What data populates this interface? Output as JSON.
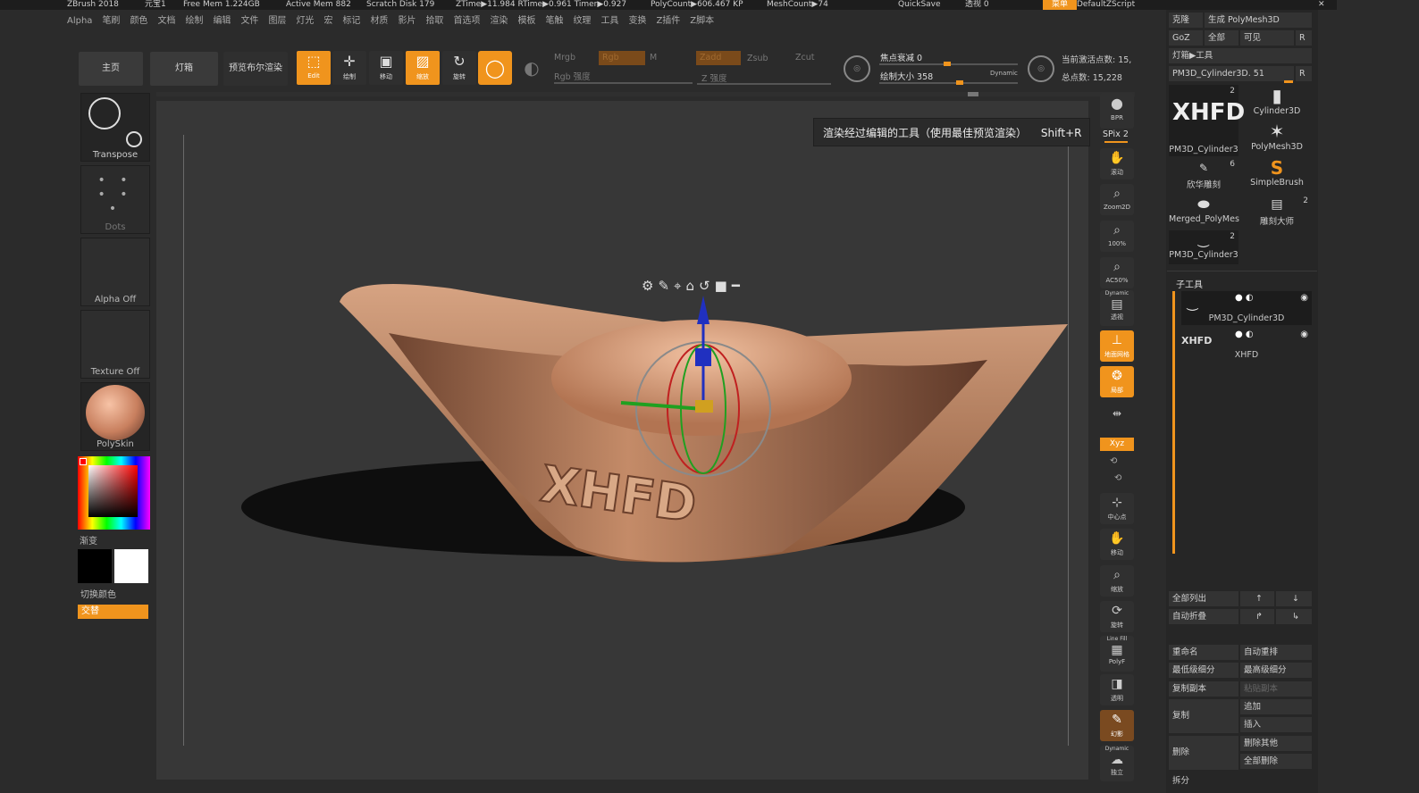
{
  "titlebar": {
    "app": "ZBrush 2018",
    "file": "元宝1",
    "free_mem": "Free Mem 1.224GB",
    "active_mem": "Active Mem 882",
    "scratch": "Scratch Disk 179",
    "ztime": "ZTime▶11.984 RTime▶0.961 Timer▶0.927",
    "polycount": "PolyCount▶606.467 KP",
    "meshcount": "MeshCount▶74",
    "quicksave": "QuickSave",
    "transparency": "透视 0",
    "menu": "菜单",
    "script": "DefaultZScript"
  },
  "menubar": [
    "Alpha",
    "笔刷",
    "颜色",
    "文档",
    "绘制",
    "编辑",
    "文件",
    "图层",
    "灯光",
    "宏",
    "标记",
    "材质",
    "影片",
    "拾取",
    "首选项",
    "渲染",
    "模板",
    "笔触",
    "纹理",
    "工具",
    "变换",
    "Z插件",
    "Z脚本"
  ],
  "toolbar": {
    "home": "主页",
    "lightbox": "灯箱",
    "preview_render": "预览布尔渲染",
    "edit": "Edit",
    "draw": "绘制",
    "move": "移动",
    "scale": "缩放",
    "rotate": "旋转",
    "mrgb": "Mrgb",
    "rgb": "Rgb",
    "m": "M",
    "rgb_intensity": "Rgb 强度",
    "zadd": "Zadd",
    "zsub": "Zsub",
    "zcut": "Zcut",
    "z_intensity": "Z 强度",
    "focal_shift": "焦点衰减 0",
    "draw_size": "绘制大小 358",
    "dynamic": "Dynamic",
    "active_points": "当前激活点数: 15,",
    "total_points": "总点数: 15,228"
  },
  "leftpanel": {
    "transpose": "Transpose",
    "dots": "Dots",
    "alpha": "Alpha Off",
    "texture": "Texture Off",
    "material": "PolySkin",
    "gradient": "渐变",
    "switch_color": "切换颜色",
    "alternate": "交替"
  },
  "tooltip": {
    "text": "渲染经过编辑的工具（使用最佳预览渲染）",
    "shortcut": "Shift+R"
  },
  "viewport": {
    "model_text": "XHFD"
  },
  "rightstrip": {
    "bpr": "BPR",
    "spix": "SPix 2",
    "scroll": "滚动",
    "zoom2d": "Zoom2D",
    "p100": "100%",
    "ac50": "AC50%",
    "dynamic": "Dynamic",
    "persp": "透视",
    "floor": "地面网格",
    "local": "局部",
    "xyz": "Xyz",
    "center": "中心点",
    "move": "移动",
    "scale": "缩放",
    "rotate": "旋转",
    "linefill": "Line Fill",
    "polyf": "PolyF",
    "transp": "透明",
    "ghost": "幻影",
    "solo": "独立"
  },
  "rightpanel": {
    "clone": "克隆",
    "make_polymesh": "生成 PolyMesh3D",
    "goz": "GoZ",
    "all": "全部",
    "visible": "可见",
    "r": "R",
    "lightbox_tools": "灯箱▶工具",
    "current_tool": "PM3D_Cylinder3D. 51",
    "tools": [
      {
        "name": "PM3D_Cylinder3",
        "count": "2"
      },
      {
        "name": "Cylinder3D",
        "count": ""
      },
      {
        "name": "PolyMesh3D",
        "count": ""
      },
      {
        "name": "欣华雕刻",
        "count": "6"
      },
      {
        "name": "SimpleBrush",
        "count": ""
      },
      {
        "name": "Merged_PolyMes",
        "count": ""
      },
      {
        "name": "雕刻大师",
        "count": "2"
      },
      {
        "name": "PM3D_Cylinder3",
        "count": "2"
      }
    ],
    "subtool_header": "子工具",
    "subtools": [
      "PM3D_Cylinder3D",
      "XHFD"
    ],
    "list_all": "全部列出",
    "auto_collapse": "自动折叠",
    "rename": "重命名",
    "auto_reorder": "自动重排",
    "lowest_subdiv": "最低级细分",
    "highest_subdiv": "最高级细分",
    "duplicate": "复制副本",
    "paste": "粘贴副本",
    "copy": "复制",
    "append": "追加",
    "insert": "插入",
    "delete": "删除",
    "delete_other": "删除其他",
    "delete_all": "全部删除",
    "split": "拆分"
  },
  "colors": {
    "accent": "#f0941d",
    "background": "#2b2b2b",
    "model": "#c8916a"
  }
}
